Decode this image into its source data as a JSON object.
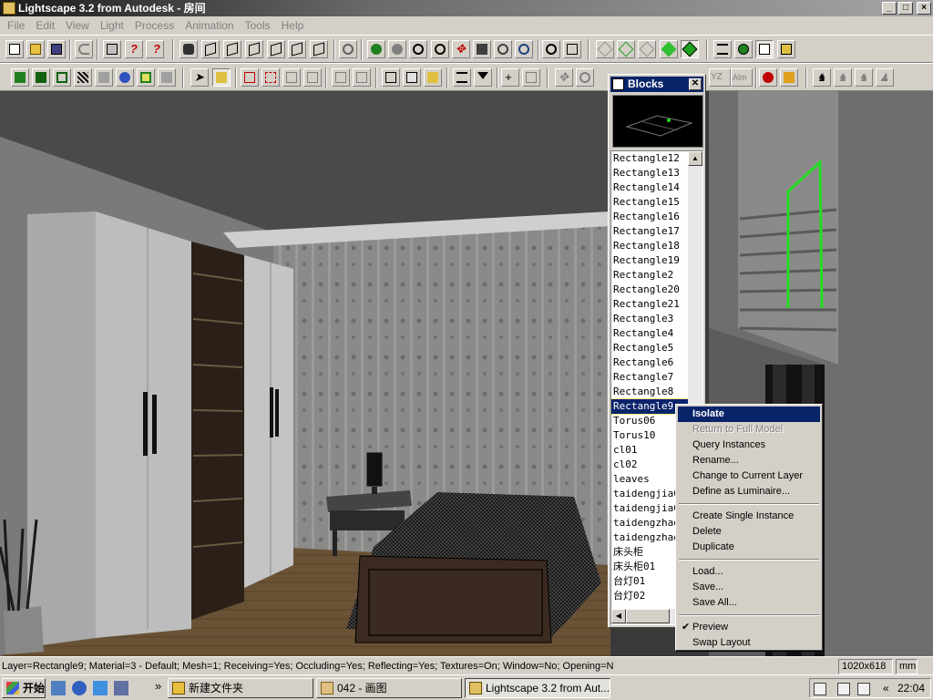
{
  "window": {
    "title": "Lightscape 3.2 from Autodesk - 房间"
  },
  "menu": [
    "File",
    "Edit",
    "View",
    "Light",
    "Process",
    "Animation",
    "Tools",
    "Help"
  ],
  "blocks_panel": {
    "title": "Blocks",
    "close_glyph": "✕",
    "items": [
      "Rectangle12",
      "Rectangle13",
      "Rectangle14",
      "Rectangle15",
      "Rectangle16",
      "Rectangle17",
      "Rectangle18",
      "Rectangle19",
      "Rectangle2",
      "Rectangle20",
      "Rectangle21",
      "Rectangle3",
      "Rectangle4",
      "Rectangle5",
      "Rectangle6",
      "Rectangle7",
      "Rectangle8",
      "Rectangle9",
      "Torus06",
      "Torus10",
      "cl01",
      "cl02",
      "leaves",
      "taidengjia01",
      "taidengjia02",
      "taidengzhao01",
      "taidengzhao02",
      "床头柜",
      "床头柜01",
      "台灯01",
      "台灯02"
    ],
    "selected": "Rectangle9"
  },
  "context_menu": {
    "isolate": "Isolate",
    "return_full": "Return to Full Model",
    "query": "Query Instances",
    "rename": "Rename...",
    "change_layer": "Change to Current Layer",
    "define_luminaire": "Define as Luminaire...",
    "create_single": "Create Single Instance",
    "delete": "Delete",
    "duplicate": "Duplicate",
    "load": "Load...",
    "save": "Save...",
    "save_all": "Save All...",
    "preview": "Preview",
    "swap_layout": "Swap Layout",
    "check_glyph": "✔"
  },
  "toolbar2_labels": {
    "yz": "YZ",
    "alm": "Alm"
  },
  "status": {
    "text": "Layer=Rectangle9; Material=3 - Default; Mesh=1; Receiving=Yes; Occluding=Yes; Reflecting=Yes; Textures=On; Window=No; Opening=N",
    "resolution": "1020x618",
    "units": "mm"
  },
  "taskbar": {
    "start": "开始",
    "tasks": [
      "新建文件夹",
      "042 - 画图",
      "Lightscape 3.2 from Aut..."
    ],
    "chevron": "»",
    "clock": "22:04",
    "tray_arrow": "«"
  },
  "colors": {
    "selection": "#0a246a",
    "accent_green": "#22dd22"
  }
}
